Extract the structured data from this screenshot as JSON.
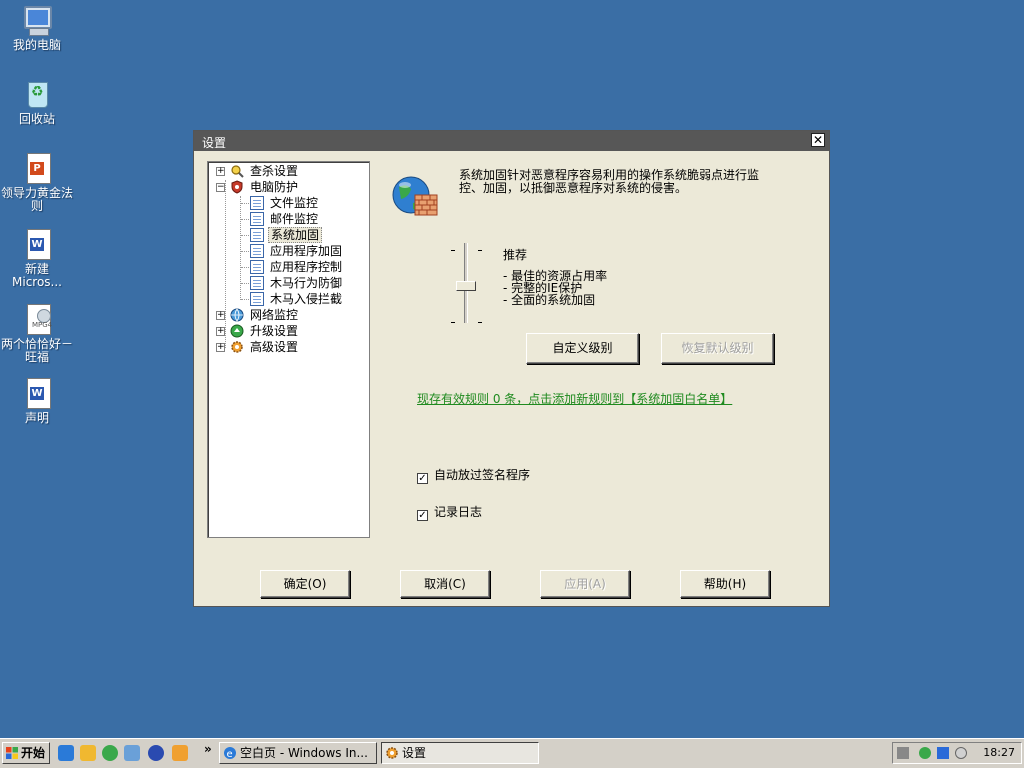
{
  "desktop": {
    "icons": [
      {
        "label": "我的电脑",
        "icon": "my-computer-icon"
      },
      {
        "label": "回收站",
        "icon": "recycle-bin-icon"
      },
      {
        "label": "领导力黄金法则",
        "icon": "powerpoint-file-icon"
      },
      {
        "label": "新建 Micros...",
        "icon": "word-file-icon"
      },
      {
        "label": "两个恰恰好－旺福",
        "icon": "mp4-file-icon"
      },
      {
        "label": "声明",
        "icon": "word-file-icon"
      }
    ]
  },
  "dialog": {
    "title": "设置",
    "close_glyph": "✕",
    "tree": {
      "items": [
        {
          "label": "查杀设置",
          "expander": "+",
          "icon": "scan-settings-icon"
        },
        {
          "label": "电脑防护",
          "expander": "−",
          "icon": "shield-icon"
        },
        {
          "label": "文件监控",
          "icon": "page-icon"
        },
        {
          "label": "邮件监控",
          "icon": "page-icon"
        },
        {
          "label": "系统加固",
          "icon": "page-icon",
          "selected": true
        },
        {
          "label": "应用程序加固",
          "icon": "page-icon"
        },
        {
          "label": "应用程序控制",
          "icon": "page-icon"
        },
        {
          "label": "木马行为防御",
          "icon": "page-icon"
        },
        {
          "label": "木马入侵拦截",
          "icon": "page-icon"
        },
        {
          "label": "网络监控",
          "expander": "+",
          "icon": "network-icon"
        },
        {
          "label": "升级设置",
          "expander": "+",
          "icon": "update-icon"
        },
        {
          "label": "高级设置",
          "expander": "+",
          "icon": "advanced-settings-icon"
        }
      ]
    },
    "content": {
      "description": "系统加固针对恶意程序容易利用的操作系统脆弱点进行监控、加固，以抵御恶意程序对系统的侵害。",
      "level_name": "推荐",
      "level_features": [
        "- 最佳的资源占用率",
        "- 完整的IE保护",
        "- 全面的系统加固"
      ],
      "custom_level_button": "自定义级别",
      "restore_default_button": "恢复默认级别",
      "rule_link": "现存有效规则 0 条，点击添加新规则到【系统加固白名单】",
      "checkbox_signed": "自动放过签名程序",
      "checkbox_log": "记录日志",
      "check_glyph": "✓"
    },
    "buttons": {
      "ok": "确定(O)",
      "cancel": "取消(C)",
      "apply": "应用(A)",
      "help": "帮助(H)"
    }
  },
  "taskbar": {
    "start_label": "开始",
    "more_glyph": "»",
    "tasks": [
      {
        "label": "空白页 - Windows In...",
        "icon": "ie-icon"
      },
      {
        "label": "设置",
        "icon": "settings-app-icon"
      }
    ],
    "clock": "18:27"
  },
  "colors": {
    "desktop": "#3a6ea5",
    "dialog_bg": "#ece9d8",
    "titlebar": "#575757",
    "link_green": "#1f8a1f"
  }
}
